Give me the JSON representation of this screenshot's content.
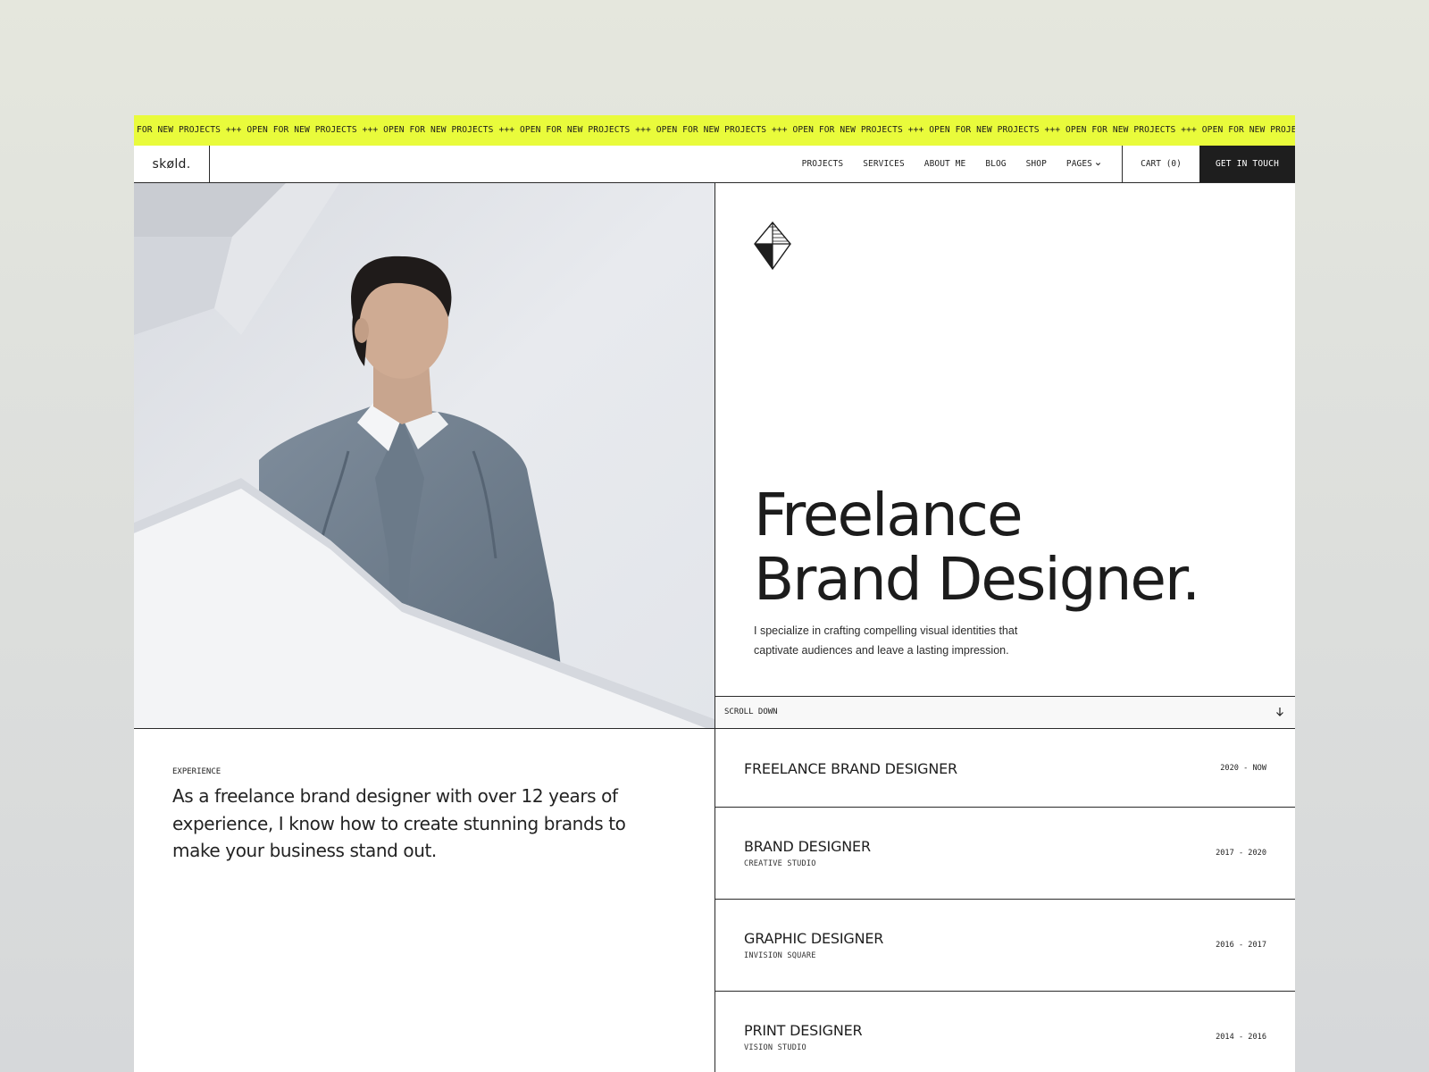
{
  "ticker": {
    "text": "FOR NEW PROJECTS +++ OPEN FOR NEW PROJECTS +++ OPEN FOR NEW PROJECTS +++ OPEN FOR NEW PROJECTS +++ OPEN FOR NEW PROJECTS +++ OPEN FOR NEW PROJECTS +++ OPEN FOR NEW PROJECTS +++ OPEN FOR NEW PROJECTS +++ OPEN FOR NEW PROJECTS +++ OPEN FOR NEW PROJECTS +++ OPEN FOR NEW"
  },
  "nav": {
    "logo": "skøld.",
    "items": [
      {
        "label": "PROJECTS"
      },
      {
        "label": "SERVICES"
      },
      {
        "label": "ABOUT ME"
      },
      {
        "label": "BLOG"
      },
      {
        "label": "SHOP"
      },
      {
        "label": "PAGES"
      }
    ],
    "cart": "CART (0)",
    "cta": "GET IN TOUCH"
  },
  "hero": {
    "headline_line1": "Freelance",
    "headline_line2": "Brand Designer.",
    "intro": "I specialize in crafting compelling visual identities that captivate audiences and leave a lasting impression.",
    "scroll_label": "SCROLL DOWN"
  },
  "experience": {
    "label": "EXPERIENCE",
    "text": "As a freelance brand designer with over 12 years of experience, I know how to create stunning brands to make your business stand out.",
    "jobs": [
      {
        "title": "FREELANCE BRAND DESIGNER",
        "company": "",
        "years": "2020 - NOW"
      },
      {
        "title": "BRAND DESIGNER",
        "company": "CREATIVE STUDIO",
        "years": "2017 - 2020"
      },
      {
        "title": "GRAPHIC DESIGNER",
        "company": "INVISION SQUARE",
        "years": "2016 - 2017"
      },
      {
        "title": "PRINT DESIGNER",
        "company": "VISION STUDIO",
        "years": "2014 - 2016"
      }
    ]
  },
  "colors": {
    "accent": "#e9fb3b",
    "ink": "#1e1e1e"
  },
  "icons": {
    "brand_mark": "diamond-mark-icon",
    "pages_dropdown": "chevron-down-icon",
    "scroll": "arrow-down-icon"
  }
}
